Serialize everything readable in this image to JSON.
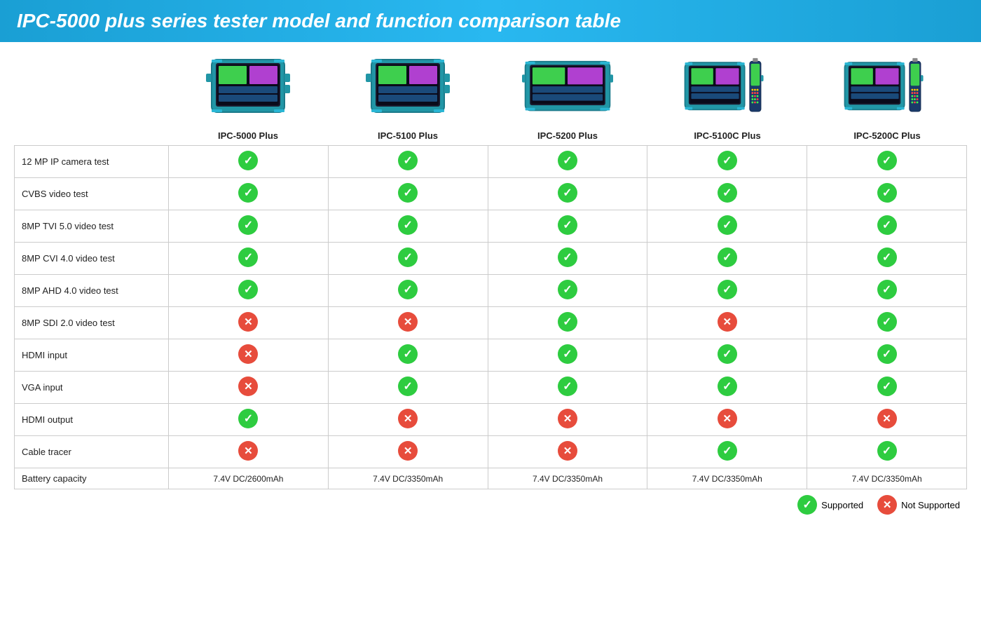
{
  "header": {
    "title": "IPC-5000 plus series tester model and function comparison table"
  },
  "products": [
    {
      "id": "ipc5000plus",
      "label": "IPC-5000 Plus",
      "type": "tablet"
    },
    {
      "id": "ipc5100plus",
      "label": "IPC-5100 Plus",
      "type": "tablet"
    },
    {
      "id": "ipc5200plus",
      "label": "IPC-5200 Plus",
      "type": "tablet-wide"
    },
    {
      "id": "ipc5100cplus",
      "label": "IPC-5100C Plus",
      "type": "tablet-cable"
    },
    {
      "id": "ipc5200cplus",
      "label": "IPC-5200C Plus",
      "type": "tablet-cable"
    }
  ],
  "features": [
    {
      "name": "12 MP IP camera test",
      "values": [
        "check",
        "check",
        "check",
        "check",
        "check"
      ]
    },
    {
      "name": "CVBS video test",
      "values": [
        "check",
        "check",
        "check",
        "check",
        "check"
      ]
    },
    {
      "name": "8MP TVI 5.0 video test",
      "values": [
        "check",
        "check",
        "check",
        "check",
        "check"
      ]
    },
    {
      "name": "8MP CVI 4.0 video test",
      "values": [
        "check",
        "check",
        "check",
        "check",
        "check"
      ]
    },
    {
      "name": "8MP AHD 4.0 video test",
      "values": [
        "check",
        "check",
        "check",
        "check",
        "check"
      ]
    },
    {
      "name": "8MP SDI 2.0 video test",
      "values": [
        "cross",
        "cross",
        "check",
        "cross",
        "check"
      ]
    },
    {
      "name": "HDMI input",
      "values": [
        "cross",
        "check",
        "check",
        "check",
        "check"
      ]
    },
    {
      "name": "VGA input",
      "values": [
        "cross",
        "check",
        "check",
        "check",
        "check"
      ]
    },
    {
      "name": "HDMI output",
      "values": [
        "check",
        "cross",
        "cross",
        "cross",
        "cross"
      ]
    },
    {
      "name": "Cable tracer",
      "values": [
        "cross",
        "cross",
        "cross",
        "check",
        "check"
      ]
    },
    {
      "name": "Battery capacity",
      "values": [
        "7.4V DC/2600mAh",
        "7.4V DC/3350mAh",
        "7.4V DC/3350mAh",
        "7.4V DC/3350mAh",
        "7.4V DC/3350mAh"
      ],
      "type": "text"
    }
  ],
  "legend": {
    "supported_label": "Supported",
    "not_supported_label": "Not Supported"
  }
}
